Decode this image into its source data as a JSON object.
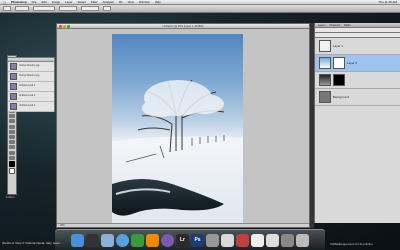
{
  "menubar": {
    "apple_icon": "apple-icon",
    "items": [
      "Photoshop",
      "File",
      "Edit",
      "Image",
      "Layer",
      "Select",
      "Filter",
      "Analysis",
      "3D",
      "View",
      "Window",
      "Help"
    ],
    "clock": "Thu 11:45 AM"
  },
  "document": {
    "title": "Untitled-1 @ 25% (Layer 1, RGB/8)",
    "status": "25%"
  },
  "layers_list": {
    "rows": [
      "Snowy Woods 1.jpg",
      "Snowy Woods 2.jpg",
      "Untitled-1.psd 1",
      "Untitled-1.psd 2",
      "Untitled-1.psd 3"
    ]
  },
  "layers_panel": {
    "tabs": [
      "Layers",
      "Channels",
      "Paths"
    ],
    "layer_names": [
      "Layer 1",
      "Layer 0",
      "Background"
    ]
  },
  "desktop": {
    "path_label": "Folders",
    "footnote": "[Fields of View 2 Yolanda Ojeda, Italy, www...",
    "credit": "CGBallpepperonio for FLorinline"
  },
  "dock": {
    "icons": [
      "finder-icon",
      "dashboard-icon",
      "mail-icon",
      "safari-icon",
      "ichat-icon",
      "vlc-icon",
      "itunes-icon",
      "lightroom-icon",
      "photoshop-icon",
      "bridge-icon",
      "preview-icon",
      "finder2-icon",
      "acrobat-icon",
      "textedit-icon",
      "calendar-icon",
      "system-prefs-icon",
      "trash-icon"
    ],
    "labels": {
      "lightroom": "Lr",
      "photoshop": "Ps"
    }
  },
  "colors": {
    "photoshop": "#1b3d74",
    "lightroom": "#2a2a2a",
    "selected_layer": "#9fc3ef"
  }
}
